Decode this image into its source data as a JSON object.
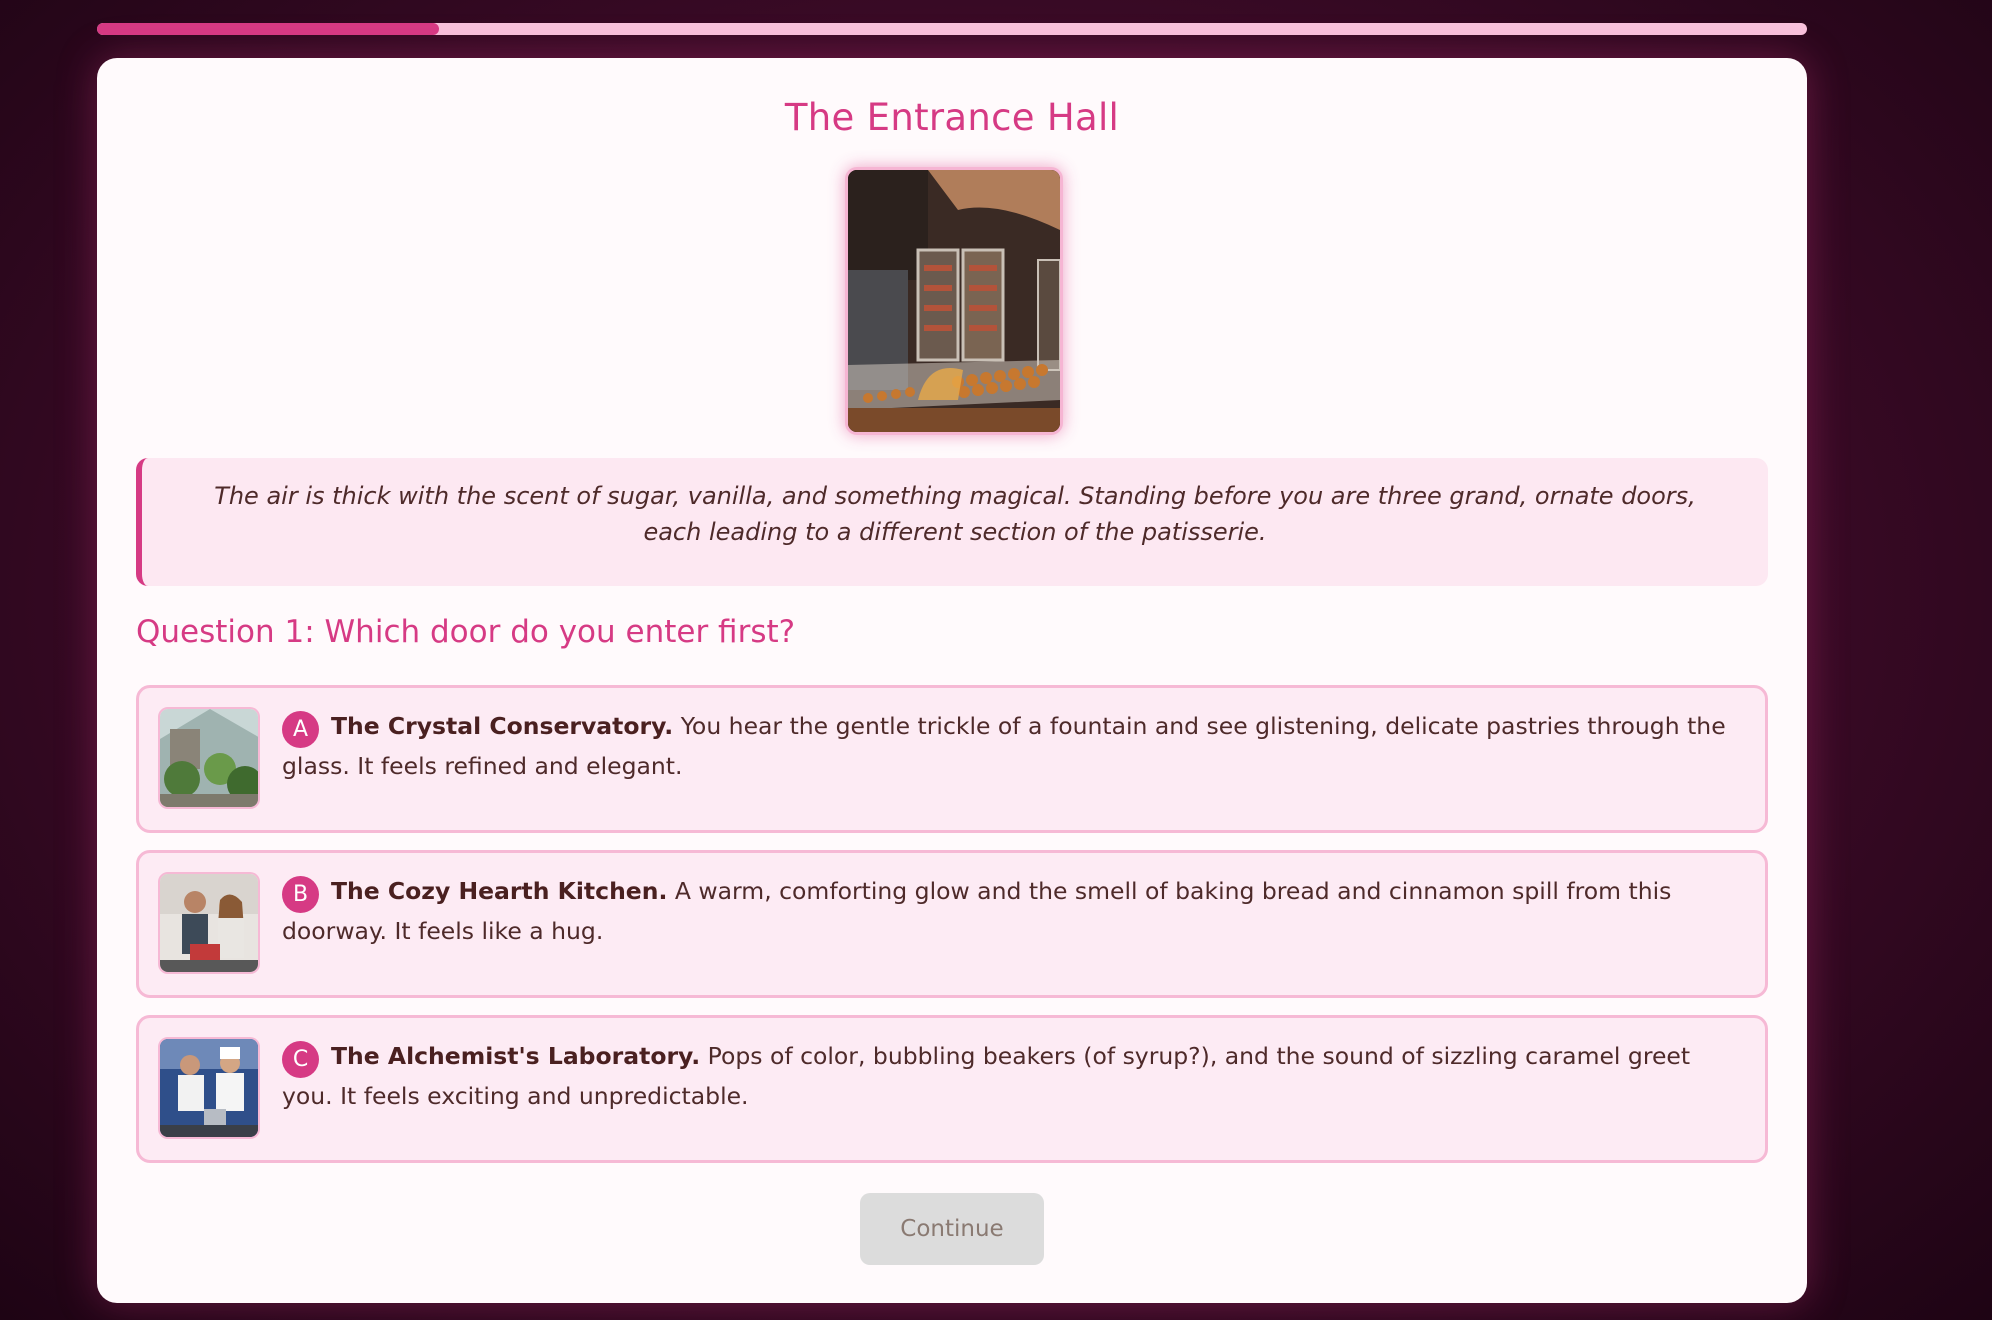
{
  "progress": {
    "fraction": 0.2
  },
  "scene": {
    "title": "The Entrance Hall",
    "image_icon": "patisserie-display-photo",
    "narration": "The air is thick with the scent of sugar, vanilla, and something magical. Standing before you are three grand, ornate doors, each leading to a different section of the patisserie."
  },
  "question": {
    "text": "Question 1: Which door do you enter first?"
  },
  "options": [
    {
      "letter": "A",
      "title": "The Crystal Conservatory.",
      "description": "You hear the gentle trickle of a fountain and see glistening, delicate pastries through the glass. It feels refined and elegant.",
      "thumb_icon": "conservatory-photo"
    },
    {
      "letter": "B",
      "title": "The Cozy Hearth Kitchen.",
      "description": "A warm, comforting glow and the smell of baking bread and cinnamon spill from this doorway. It feels like a hug.",
      "thumb_icon": "kitchen-couple-photo"
    },
    {
      "letter": "C",
      "title": "The Alchemist's Laboratory.",
      "description": "Pops of color, bubbling beakers (of syrup?), and the sound of sizzling caramel greet you. It feels exciting and unpredictable.",
      "thumb_icon": "chefs-lab-photo"
    }
  ],
  "continue_button": {
    "label": "Continue",
    "disabled": true
  },
  "colors": {
    "accent": "#d63a84",
    "accent_light": "#f9c3dd",
    "card_bg": "#fffafc",
    "option_bg": "#fdebf4",
    "text_dark": "#4e2a2a"
  }
}
